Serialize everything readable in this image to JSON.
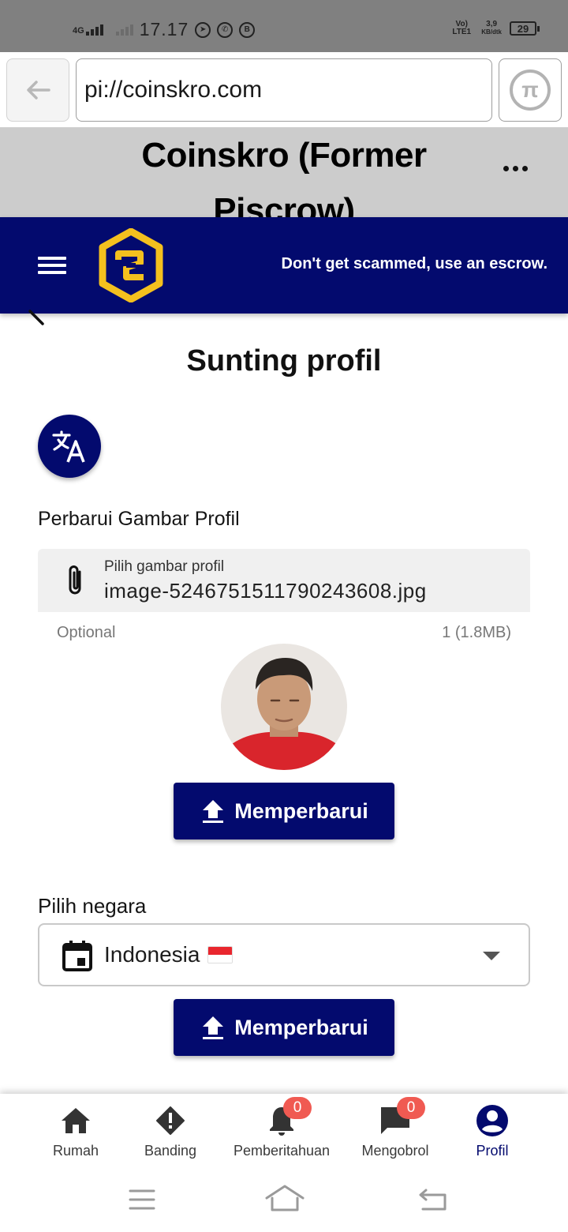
{
  "status_bar": {
    "network": "4G",
    "time": "17.17",
    "volte": "Vo) LTE1",
    "speed_value": "3,9",
    "speed_unit": "KB/dtk",
    "battery": "29",
    "icons": [
      "telegram-icon",
      "whatsapp-icon",
      "b-icon"
    ]
  },
  "browser": {
    "url": "pi://coinskro.com"
  },
  "app_banner": {
    "title": "Coinskro (Former Piscrow)"
  },
  "header": {
    "tagline": "Don't get scammed, use an escrow."
  },
  "main": {
    "page_title": "Sunting profil",
    "profile_image_section": {
      "heading": "Perbarui Gambar Profil",
      "file_label": "Pilih gambar profil",
      "file_value": "image-5246751511790243608.jpg",
      "hint_left": "Optional",
      "hint_right": "1 (1.8MB)",
      "update_label": "Memperbarui"
    },
    "country_section": {
      "heading": "Pilih negara",
      "selected_country": "Indonesia",
      "update_label": "Memperbarui"
    }
  },
  "bottom_nav": {
    "items": [
      {
        "label": "Rumah",
        "icon": "home-icon"
      },
      {
        "label": "Banding",
        "icon": "alert-icon"
      },
      {
        "label": "Pemberitahuan",
        "icon": "bell-icon",
        "badge": "0"
      },
      {
        "label": "Mengobrol",
        "icon": "chat-icon",
        "badge": "0"
      },
      {
        "label": "Profil",
        "icon": "account-icon",
        "active": true
      }
    ]
  },
  "colors": {
    "brand_navy": "#030a6e",
    "logo_gold": "#f4c01e",
    "badge_red": "#f05a52",
    "banner_grey": "#cccccc"
  }
}
